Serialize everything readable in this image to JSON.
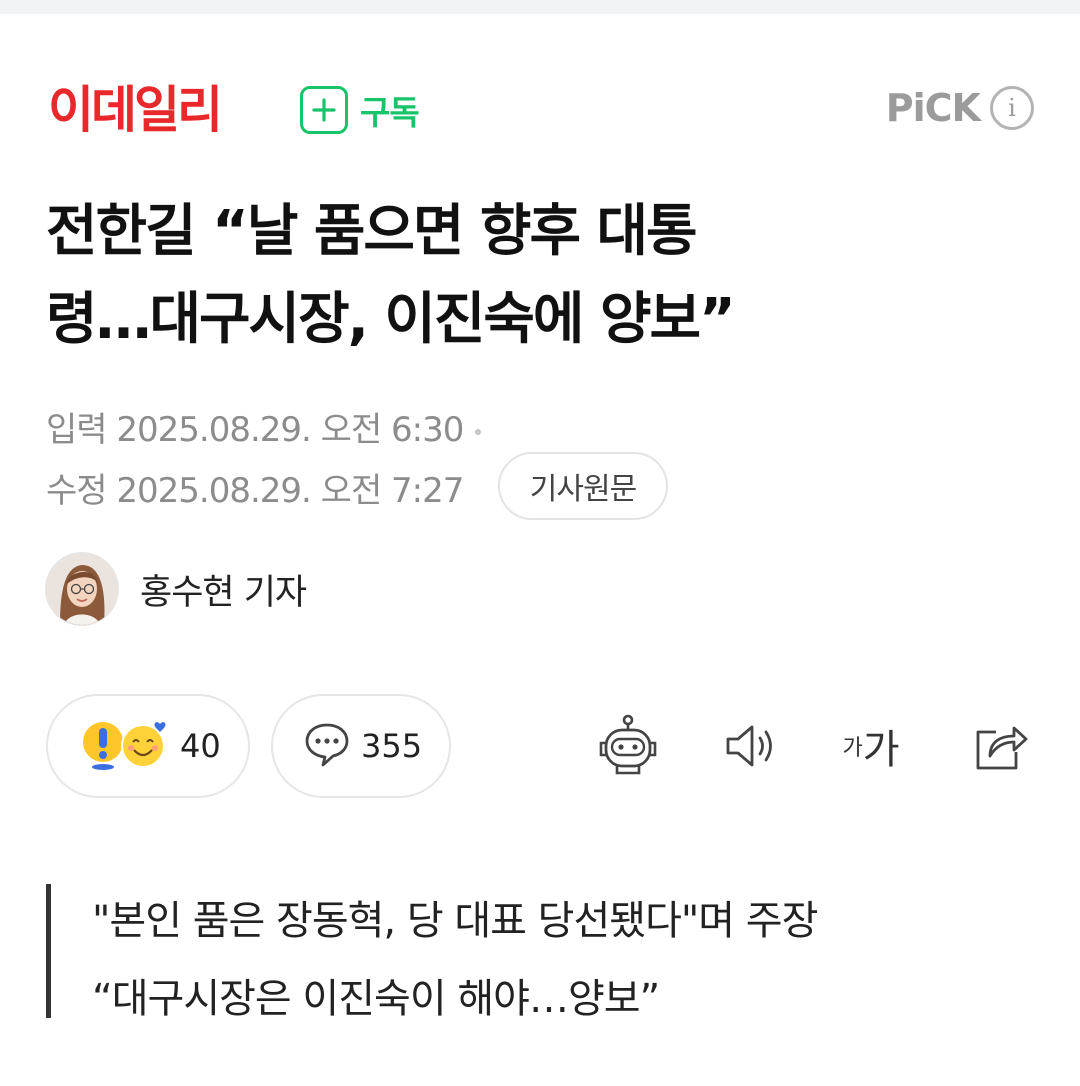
{
  "header": {
    "logo_text": "이데일리",
    "subscribe_label": "구독",
    "pick_label": "PiCK",
    "info_glyph": "i"
  },
  "article": {
    "title_line1": "전한길 “날 품으면 향후 대통",
    "title_line2": "령…대구시장, 이진숙에 양보”",
    "input_label": "입력",
    "input_datetime": "2025.08.29. 오전 6:30",
    "modified_label": "수정",
    "modified_datetime": "2025.08.29. 오전 7:27",
    "original_button": "기사원문",
    "reporter": "홍수현 기자",
    "reaction_count": "40",
    "comment_count": "355",
    "font_small": "가",
    "font_big": "가",
    "subtitle_line1": "\"본인 품은 장동혁, 당 대표 당선됐다\"며 주장",
    "subtitle_line2": "“대구시장은 이진숙이 해야…양보”"
  },
  "colors": {
    "logo_red": "#e8282b",
    "subscribe_green": "#17c46a",
    "meta_gray": "#8c8c8c"
  },
  "icons": [
    "plus-icon",
    "info-icon",
    "exclaim-emoji-icon",
    "smile-emoji-icon",
    "comment-icon",
    "bot-summary-icon",
    "speaker-icon",
    "share-icon"
  ]
}
